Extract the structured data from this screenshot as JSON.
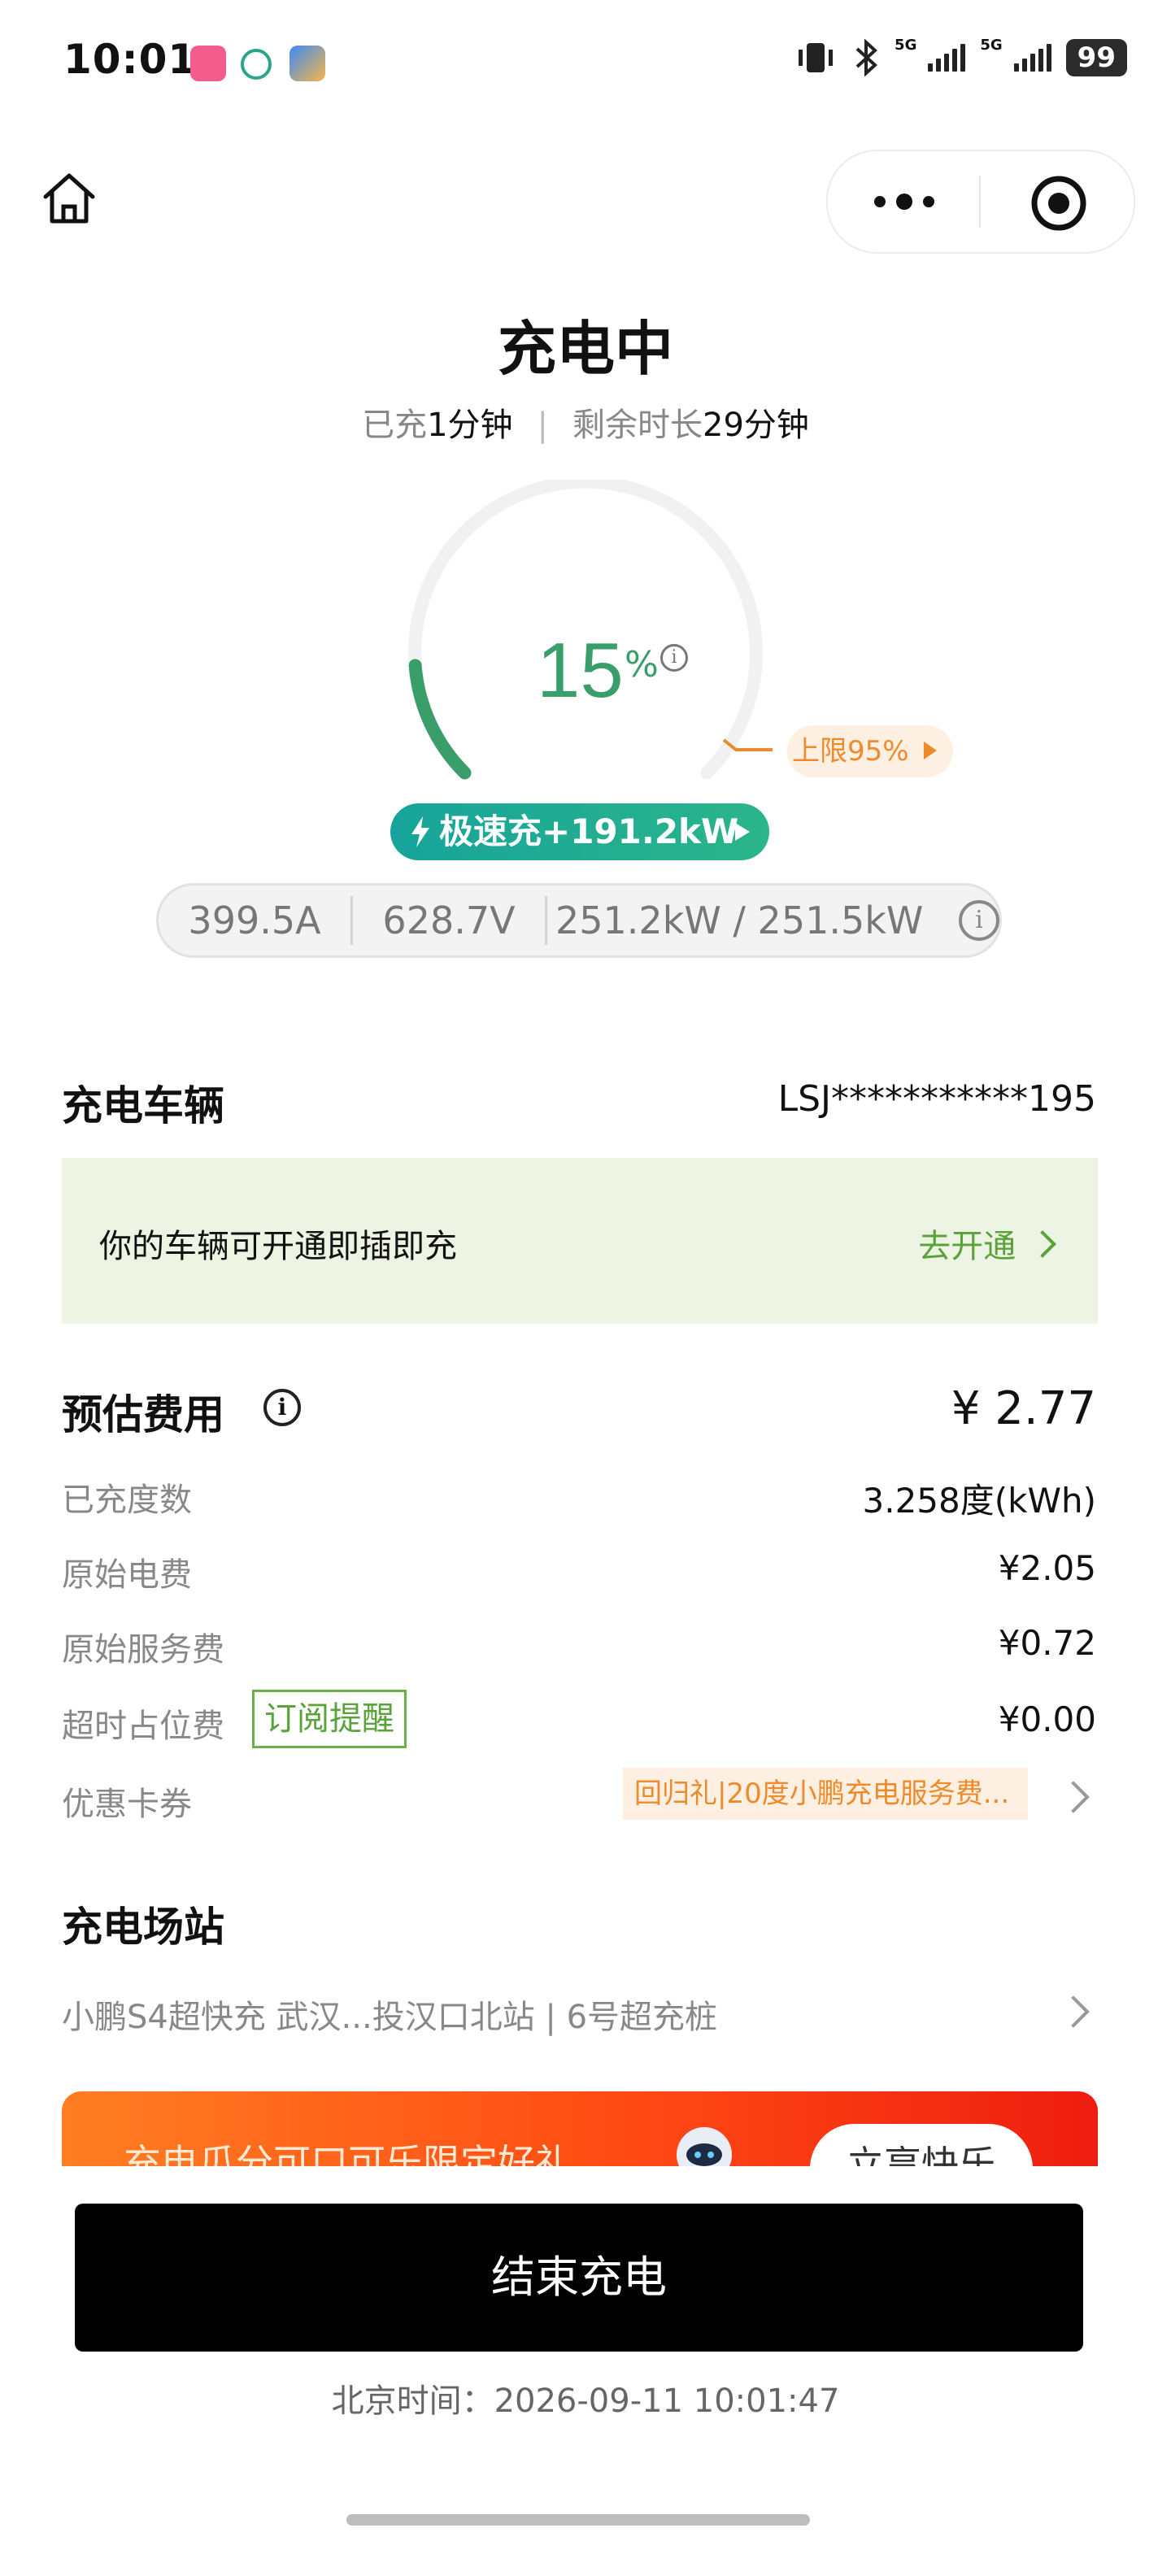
{
  "status_bar": {
    "time": "10:01",
    "network_1": "5G",
    "network_2": "5G",
    "battery": "99"
  },
  "header": {
    "title": "充电中",
    "charged_label": "已充",
    "charged_value": "1分钟",
    "remaining_label": "剩余时长",
    "remaining_value": "29分钟"
  },
  "gauge": {
    "percent": "15",
    "percent_sign": "%",
    "limit_label": "上限95%",
    "fast_charge_label": "极速充+191.2kW",
    "level": 0.15
  },
  "metrics": {
    "current": "399.5A",
    "voltage": "628.7V",
    "power": "251.2kW / 251.5kW"
  },
  "vehicle": {
    "section_title": "充电车辆",
    "vin": "LSJ***********195",
    "notice": "你的车辆可开通即插即充",
    "activate_label": "去开通"
  },
  "fees": {
    "section_title": "预估费用",
    "total": "¥ 2.77",
    "rows": [
      {
        "label": "已充度数",
        "value": "3.258度(kWh)"
      },
      {
        "label": "原始电费",
        "value": "¥2.05"
      },
      {
        "label": "原始服务费",
        "value": "¥0.72"
      },
      {
        "label": "超时占位费",
        "value": "¥0.00"
      }
    ],
    "subscribe_label": "订阅提醒",
    "coupon_label": "优惠卡券",
    "coupon_value": "回归礼|20度小鹏充电服务费..."
  },
  "station": {
    "section_title": "充电场站",
    "name": "小鹏S4超快充 武汉...投汉口北站 | 6号超充桩"
  },
  "banner": {
    "text": "充电瓜分可口可乐限定好礼",
    "button": "立享快乐"
  },
  "footer": {
    "end_button": "结束充电",
    "beijing_time_label": "北京时间：",
    "beijing_time_value": "2026-09-11 10:01:47"
  },
  "colors": {
    "accent_green": "#3a9e6b",
    "orange": "#ee8a2a",
    "teal": "#17a49a",
    "link_green": "#59a33a"
  }
}
